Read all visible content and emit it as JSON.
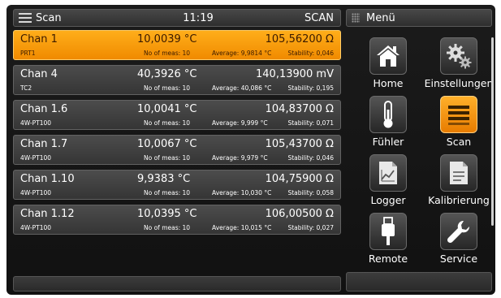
{
  "header": {
    "title": "Scan",
    "time": "11:19",
    "mode": "SCAN"
  },
  "menu": {
    "title": "Menü",
    "items": [
      {
        "label": "Home",
        "icon": "home-icon"
      },
      {
        "label": "Einstellungen",
        "icon": "gears-icon"
      },
      {
        "label": "Fühler",
        "icon": "thermometer-icon"
      },
      {
        "label": "Scan",
        "icon": "scan-list-icon",
        "active": true
      },
      {
        "label": "Logger",
        "icon": "logger-chart-icon"
      },
      {
        "label": "Kalibrierung",
        "icon": "calibration-document-icon"
      },
      {
        "label": "Remote",
        "icon": "usb-plug-icon"
      },
      {
        "label": "Service",
        "icon": "wrench-icon"
      }
    ]
  },
  "channels": [
    {
      "name": "Chan 1",
      "temp": "10,0039 °C",
      "value": "105,56200 Ω",
      "sensor": "PRT1",
      "meas": "No of meas: 10",
      "average": "Average: 9,9814 °C",
      "stability": "Stability: 0,046",
      "active": true
    },
    {
      "name": "Chan 4",
      "temp": "40,3926 °C",
      "value": "140,13900 mV",
      "sensor": "TC2",
      "meas": "No of meas: 10",
      "average": "Average: 40,086 °C",
      "stability": "Stability: 0,195"
    },
    {
      "name": "Chan 1.6",
      "temp": "10,0041 °C",
      "value": "104,83700 Ω",
      "sensor": "4W-PT100",
      "meas": "No of meas: 10",
      "average": "Average: 9,999 °C",
      "stability": "Stability: 0,071"
    },
    {
      "name": "Chan 1.7",
      "temp": "10,0067 °C",
      "value": "105,43700 Ω",
      "sensor": "4W-PT100",
      "meas": "No of meas: 10",
      "average": "Average: 9,979 °C",
      "stability": "Stability: 0,046"
    },
    {
      "name": "Chan 1.10",
      "temp": "9,9383 °C",
      "value": "104,75900 Ω",
      "sensor": "4W-PT100",
      "meas": "No of meas: 10",
      "average": "Average: 10,030 °C",
      "stability": "Stability: 0,058"
    },
    {
      "name": "Chan 1.12",
      "temp": "10,0395 °C",
      "value": "106,00500 Ω",
      "sensor": "4W-PT100",
      "meas": "No of meas: 10",
      "average": "Average: 10,015 °C",
      "stability": "Stability: 0,027"
    }
  ],
  "colors": {
    "accent": "#f5990a",
    "panel": "#3e3e3e",
    "background": "#141414"
  }
}
